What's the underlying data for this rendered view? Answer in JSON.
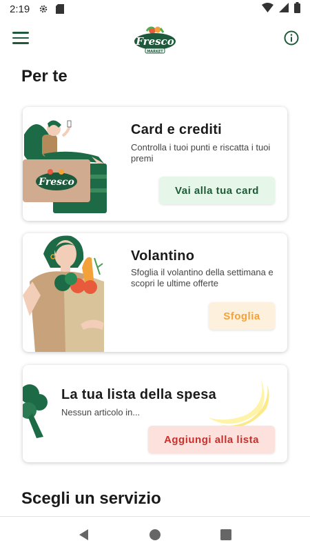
{
  "status_bar": {
    "time": "2:19"
  },
  "header": {
    "logo_text": "Fresco",
    "logo_subtext": "MARKET"
  },
  "section_for_you": "Per te",
  "cards": [
    {
      "title": "Card e crediti",
      "description": "Controlla i tuoi punti e riscatta i tuoi premi",
      "button_label": "Vai alla tua card",
      "button_bg": "#e6f7e9",
      "button_color": "#1f5a37"
    },
    {
      "title": "Volantino",
      "description": "Sfoglia il volantino della settimana e scopri le ultime offerte",
      "button_label": "Sfoglia",
      "button_bg": "#fdf0dc",
      "button_color": "#f3a23a"
    },
    {
      "title": "La tua lista della spesa",
      "description": "Nessun articolo in...",
      "button_label": "Aggiungi alla lista",
      "button_bg": "#fde1dd",
      "button_color": "#c8302c"
    }
  ],
  "section_services": "Scegli un servizio",
  "colors": {
    "brand_green": "#1d5a3b",
    "accent_orange": "#f3a23a",
    "accent_red": "#c8302c"
  }
}
